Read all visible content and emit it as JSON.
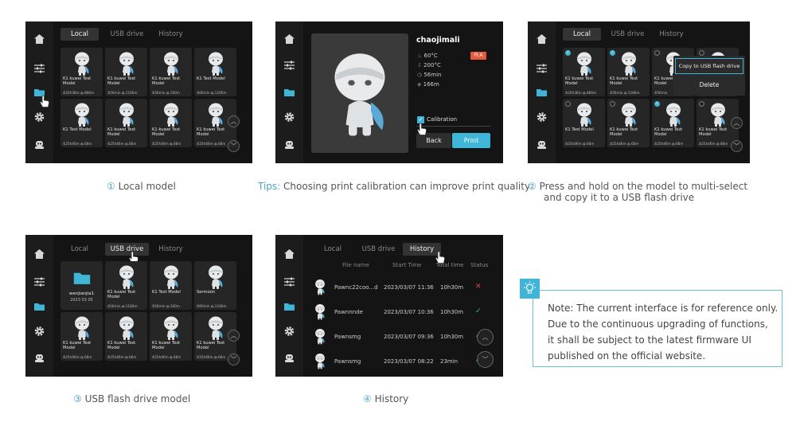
{
  "tabs": {
    "local": "Local",
    "usb": "USB drive",
    "history": "History"
  },
  "scr1": {
    "cards": [
      {
        "name": "K1 kuwei Test Model",
        "stats": "⏱20h38m ◍.866m"
      },
      {
        "name": "K1 kuwei Test Model",
        "stats": "⏱56min ◍.1166m"
      },
      {
        "name": "K1 kuwei Test Model",
        "stats": "⏱56min ◍.100m"
      },
      {
        "name": "K1 Test Model",
        "stats": "⏱60min ◍.1166m"
      },
      {
        "name": "K1 Test Model",
        "stats": "⏱25h46m ◍.66m"
      },
      {
        "name": "K1 kuwei Test Model",
        "stats": "⏱25h46m ◍.66m"
      },
      {
        "name": "K1 kuwei Test Model",
        "stats": "⏱25h46m ◍.66m"
      },
      {
        "name": "K1 kuwei Test Model",
        "stats": "⏱25h46m ◍.66m"
      }
    ]
  },
  "scr2": {
    "title": "chaojimali",
    "badge": "PLA",
    "bed_temp": "60°C",
    "nozzle_temp": "200°C",
    "time": "56min",
    "length": "166m",
    "calibration": "Calibration",
    "back": "Back",
    "print": "Print"
  },
  "scr3": {
    "menu_copy": "Copy to USB flash drive",
    "menu_delete": "Delete",
    "cards": [
      {
        "name": "K1 kuwei Test Model",
        "stats": "⏱20h38m ◍.866m"
      },
      {
        "name": "K1 kuwei Test Model",
        "stats": "⏱56min ◍.1166m"
      },
      {
        "name": "K1 kuwei Test Model",
        "stats": "⏱56min"
      },
      {
        "name": "",
        "stats": ""
      },
      {
        "name": "K1 Test Model",
        "stats": "⏱25h46m ◍.66m"
      },
      {
        "name": "K1 kuwei Test Model",
        "stats": "⏱25h46m ◍.66m"
      },
      {
        "name": "K1 kuwei Test Model",
        "stats": "⏱25h46m ◍.66m"
      },
      {
        "name": "K1 kuwei Test Model",
        "stats": "⏱25h46m ◍.66m"
      }
    ]
  },
  "scr4": {
    "folder_name": "wenjianjia1",
    "folder_date": "2023 03 05",
    "cards": [
      {
        "name": "K1 kuwei Test Model",
        "stats": "⏱56min ◍.1166m"
      },
      {
        "name": "K1 Test Model",
        "stats": "⏱56min ◍.100m"
      },
      {
        "name": "Sermoon",
        "stats": "⏱60min ◍.1166m"
      },
      {
        "name": "K1 kuwei Test Model",
        "stats": "⏱25h46m ◍.66m"
      },
      {
        "name": "K1 kuwei Test Model",
        "stats": "⏱25h46m ◍.66m"
      },
      {
        "name": "K1 kuwei Test Model",
        "stats": "⏱25h46m ◍.66m"
      },
      {
        "name": "K1 kuwei Test Model",
        "stats": "⏱25h46m ◍.66m"
      }
    ]
  },
  "scr5": {
    "headers": {
      "file": "File name",
      "start": "Start Time",
      "total": "Total time",
      "status": "Status"
    },
    "rows": [
      {
        "file": "Pawnc22coo...d",
        "start": "2023/03/07 11:36",
        "total": "10h30m",
        "status": "✕"
      },
      {
        "file": "Pawnnnde",
        "start": "2023/03/07 10:36",
        "total": "10h30m",
        "status": "✓"
      },
      {
        "file": "Pawnsmg",
        "start": "2023/03/07 09:36",
        "total": "10h30m",
        "status": "✓"
      },
      {
        "file": "Pawnsmg",
        "start": "2023/03/07 08:22",
        "total": "23min",
        "status": "✓"
      }
    ]
  },
  "captions": {
    "c1_num": "①",
    "c1": " Local model",
    "tips_label": "Tips:",
    "tips": " Choosing print calibration can improve print quality",
    "c2_num": "②",
    "c2_line1": " Press and hold on the model to multi-select",
    "c2_line2": "and copy it to a USB flash drive",
    "c3_num": "③",
    "c3": " USB flash drive model",
    "c4_num": "④",
    "c4": " History"
  },
  "note": {
    "line1": "Note: The current interface is for reference only.",
    "line2": "Due to the continuous upgrading of functions,",
    "line3": "it shall be subject to the latest firmware UI",
    "line4": "published on the official website."
  },
  "colors": {
    "accent": "#3fb6d8",
    "badge": "#e8593a",
    "success": "#3fc47a",
    "fail": "#e04848"
  }
}
